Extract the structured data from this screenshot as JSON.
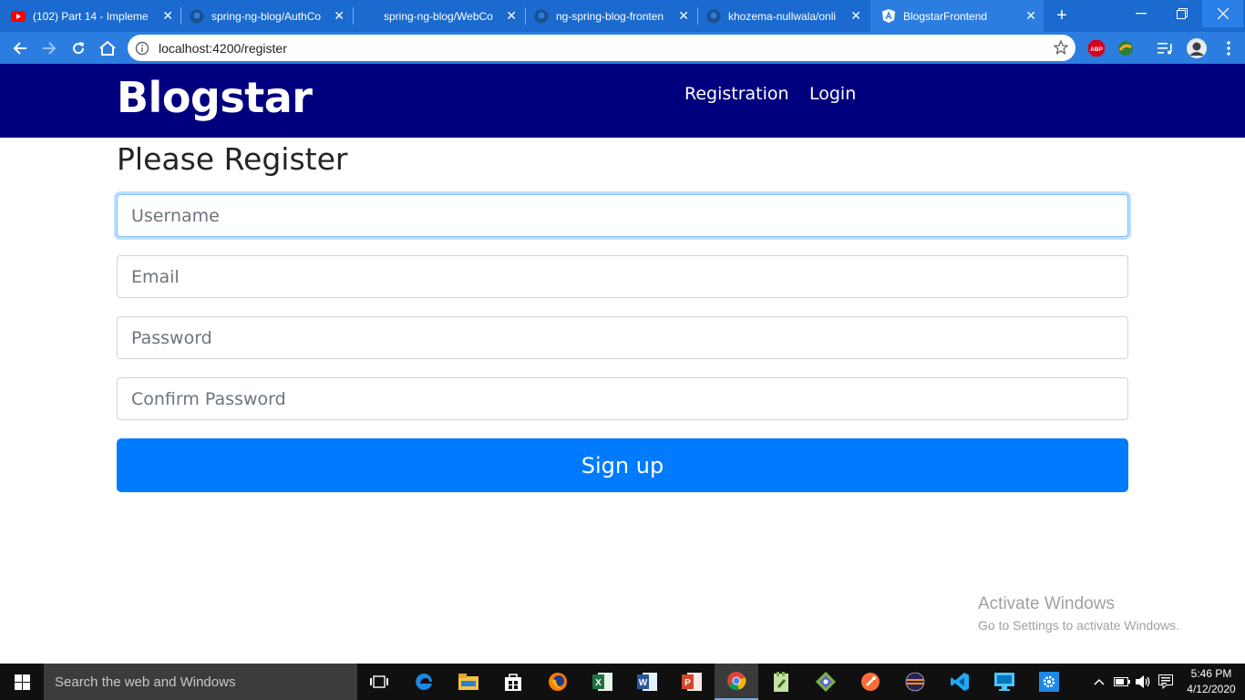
{
  "browser": {
    "tabs": [
      {
        "title": "(102) Part 14 - Impleme",
        "icon": "youtube-icon"
      },
      {
        "title": "spring-ng-blog/AuthCo",
        "icon": "github-icon"
      },
      {
        "title": "spring-ng-blog/WebCo",
        "icon": "github-icon"
      },
      {
        "title": "ng-spring-blog-fronten",
        "icon": "github-icon"
      },
      {
        "title": "khozema-nullwala/onli",
        "icon": "github-icon"
      },
      {
        "title": "BlogstarFrontend",
        "icon": "angular-icon"
      }
    ],
    "active_tab": 5,
    "url": "localhost:4200/register",
    "extensions": [
      "adblock-icon",
      "extension-icon",
      "media-queue-icon",
      "profile-avatar"
    ]
  },
  "site": {
    "brand": "Blogstar",
    "nav": {
      "registration": "Registration",
      "login": "Login"
    },
    "header_color": "#00007f"
  },
  "form": {
    "heading": "Please Register",
    "fields": {
      "username": {
        "placeholder": "Username",
        "value": ""
      },
      "email": {
        "placeholder": "Email",
        "value": ""
      },
      "password": {
        "placeholder": "Password",
        "value": ""
      },
      "confirm_password": {
        "placeholder": "Confirm Password",
        "value": ""
      }
    },
    "focused_field": "username",
    "submit_label": "Sign up",
    "submit_color": "#007bff"
  },
  "watermark": {
    "line1": "Activate Windows",
    "line2": "Go to Settings to activate Windows."
  },
  "taskbar": {
    "search_placeholder": "Search the web and Windows",
    "apps": [
      "task-view",
      "edge",
      "file-explorer",
      "store",
      "firefox",
      "excel",
      "word",
      "powerpoint",
      "chrome",
      "notepad-plus-plus",
      "git-kraken",
      "postman",
      "eclipse",
      "vscode",
      "remote-desktop",
      "settings"
    ],
    "active_app": "chrome",
    "time": "5:46 PM",
    "date": "4/12/2020"
  }
}
